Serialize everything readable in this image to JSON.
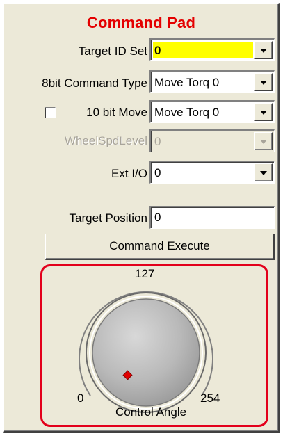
{
  "command_pad": {
    "title": "Command Pad",
    "target_id_set": {
      "label": "Target ID Set",
      "value": "0",
      "highlight_color": "#ffff00"
    },
    "command_type_8bit": {
      "label": "8bit Command Type",
      "value": "Move Torq 0"
    },
    "move_10bit": {
      "label": "10 bit Move",
      "checked": false,
      "value": "Move Torq 0"
    },
    "wheel_spd_level": {
      "label": "WheelSpdLevel",
      "value": "0",
      "enabled": false
    },
    "ext_io": {
      "label": "Ext I/O",
      "value": "0"
    },
    "target_position": {
      "label": "Target Position",
      "value": "0"
    },
    "execute_button": {
      "label": "Command Execute"
    },
    "control_angle": {
      "label": "Control Angle",
      "min_label": "0",
      "mid_label": "127",
      "max_label": "254",
      "frame_color": "#e3001b",
      "indicator_color": "#e00000"
    }
  }
}
